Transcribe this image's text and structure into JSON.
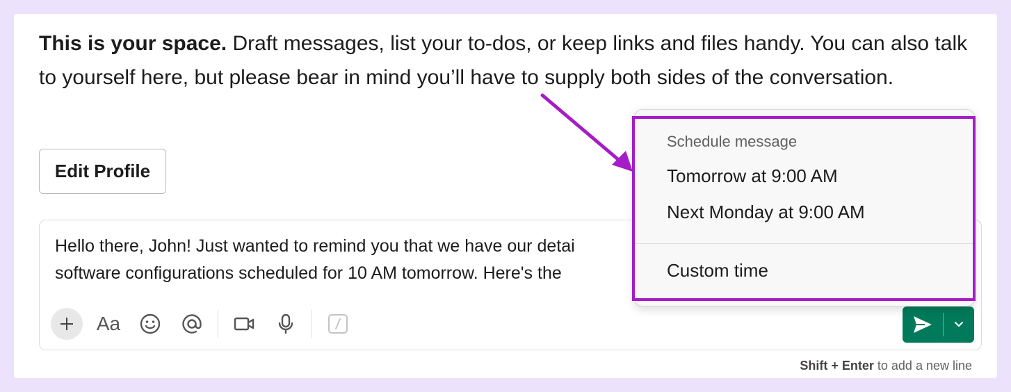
{
  "intro": {
    "bold": "This is your space.",
    "text": " Draft messages, list your to-dos, or keep links and files handy. You can also talk to yourself here, but please bear in mind you’ll have to supply both sides of the conversation."
  },
  "edit_profile_label": "Edit Profile",
  "composer": {
    "text": "Hello there, John! Just wanted to remind you that we have our detai\nsoftware configurations scheduled for 10 AM tomorrow. Here's the",
    "format_label": "Aa"
  },
  "hint": {
    "keys": "Shift + Enter",
    "text": " to add a new line"
  },
  "schedule_popup": {
    "heading": "Schedule message",
    "options": [
      "Tomorrow at 9:00 AM",
      "Next Monday at 9:00 AM",
      "Custom time"
    ]
  },
  "colors": {
    "background": "#ece2fb",
    "send_button": "#007a5a",
    "highlight": "#a51dc6"
  },
  "icons": [
    "plus-icon",
    "format-icon",
    "emoji-icon",
    "mention-icon",
    "video-icon",
    "microphone-icon",
    "slash-command-icon",
    "send-icon",
    "chevron-down-icon"
  ]
}
